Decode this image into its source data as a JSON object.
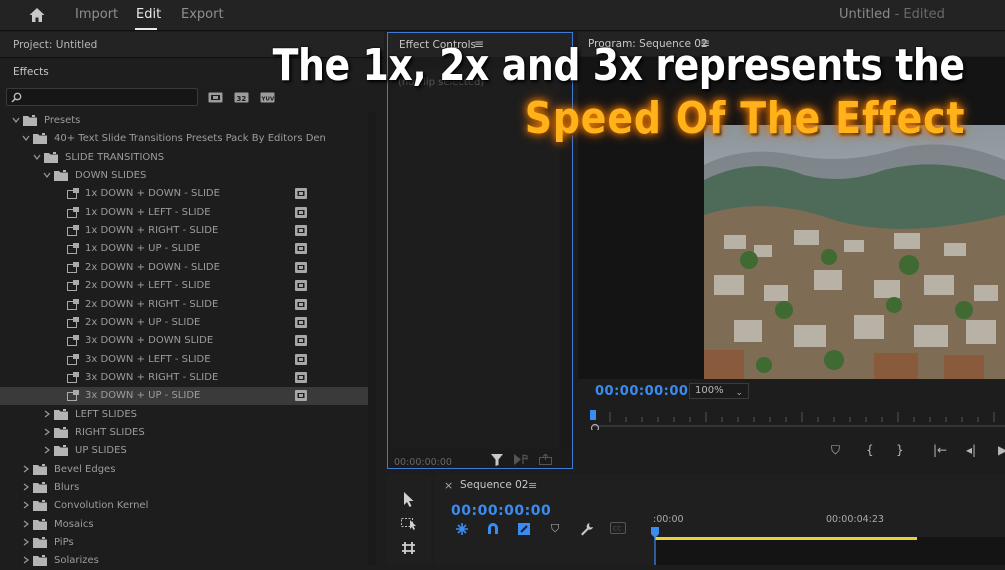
{
  "menu": {
    "tabs": [
      "Import",
      "Edit",
      "Export"
    ],
    "active_tab": "Edit",
    "doc_title": "Untitled",
    "doc_status": "- Edited"
  },
  "project": {
    "title": "Project: Untitled",
    "effects_label": "Effects"
  },
  "tree": [
    {
      "label": "Presets",
      "type": "folder",
      "depth": 0,
      "expanded": true
    },
    {
      "label": "40+ Text Slide Transitions Presets Pack By Editors Den",
      "type": "folder",
      "depth": 1,
      "expanded": true
    },
    {
      "label": "SLIDE TRANSITIONS",
      "type": "folder",
      "depth": 2,
      "expanded": true
    },
    {
      "label": "DOWN SLIDES",
      "type": "folder",
      "depth": 3,
      "expanded": true
    },
    {
      "label": "1x DOWN + DOWN - SLIDE",
      "type": "preset",
      "depth": 4
    },
    {
      "label": "1x DOWN + LEFT - SLIDE",
      "type": "preset",
      "depth": 4
    },
    {
      "label": "1x DOWN + RIGHT - SLIDE",
      "type": "preset",
      "depth": 4
    },
    {
      "label": "1x DOWN + UP - SLIDE",
      "type": "preset",
      "depth": 4
    },
    {
      "label": "2x DOWN + DOWN - SLIDE",
      "type": "preset",
      "depth": 4
    },
    {
      "label": "2x DOWN + LEFT - SLIDE",
      "type": "preset",
      "depth": 4
    },
    {
      "label": "2x DOWN + RIGHT - SLIDE",
      "type": "preset",
      "depth": 4
    },
    {
      "label": "2x DOWN + UP - SLIDE",
      "type": "preset",
      "depth": 4
    },
    {
      "label": "3x DOWN + DOWN SLIDE",
      "type": "preset",
      "depth": 4
    },
    {
      "label": "3x DOWN + LEFT - SLIDE",
      "type": "preset",
      "depth": 4
    },
    {
      "label": "3x DOWN + RIGHT - SLIDE",
      "type": "preset",
      "depth": 4
    },
    {
      "label": "3x DOWN + UP - SLIDE",
      "type": "preset",
      "depth": 4,
      "selected": true
    },
    {
      "label": "LEFT SLIDES",
      "type": "folder",
      "depth": 3,
      "expanded": false
    },
    {
      "label": "RIGHT SLIDES",
      "type": "folder",
      "depth": 3,
      "expanded": false
    },
    {
      "label": "UP SLIDES",
      "type": "folder",
      "depth": 3,
      "expanded": false
    },
    {
      "label": "Bevel Edges",
      "type": "folder",
      "depth": 1,
      "expanded": false
    },
    {
      "label": "Blurs",
      "type": "folder",
      "depth": 1,
      "expanded": false
    },
    {
      "label": "Convolution Kernel",
      "type": "folder",
      "depth": 1,
      "expanded": false
    },
    {
      "label": "Mosaics",
      "type": "folder",
      "depth": 1,
      "expanded": false
    },
    {
      "label": "PiPs",
      "type": "folder",
      "depth": 1,
      "expanded": false
    },
    {
      "label": "Solarizes",
      "type": "folder",
      "depth": 1,
      "expanded": false
    }
  ],
  "effect_controls": {
    "title": "Effect Controls",
    "no_clip": "(no clip selected)",
    "timecode": "00:00:00:00"
  },
  "program": {
    "title": "Program: Sequence 02",
    "timecode": "00:00:00:00",
    "zoom": "100%"
  },
  "sequence": {
    "title": "Sequence 02",
    "timecode": "00:00:00:00",
    "ruler_start": ":00:00",
    "ruler_mark": "00:00:04:23"
  },
  "overlay": {
    "line1": "The 1x, 2x and 3x represents the",
    "line2": "Speed Of The Effect"
  },
  "colors": {
    "accent_blue": "#3b8cf0",
    "highlight_orange": "#ffb21a",
    "work_area_yellow": "#e7d23a"
  }
}
